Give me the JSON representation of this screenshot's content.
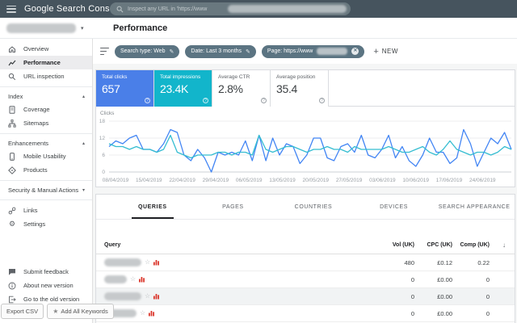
{
  "topbar": {
    "app_title": "Google Search Console",
    "search_placeholder": "Inspect any URL in 'https://www",
    "search_url_redacted": true
  },
  "property_selector": {
    "redacted": true
  },
  "page": {
    "title": "Performance"
  },
  "sidebar": {
    "items": [
      {
        "label": "Overview",
        "icon": "home-icon"
      },
      {
        "label": "Performance",
        "icon": "performance-chart-icon",
        "active": true
      },
      {
        "label": "URL inspection",
        "icon": "magnifier-icon"
      }
    ],
    "sections": [
      {
        "label": "Index",
        "state": "expanded",
        "items": [
          {
            "label": "Coverage",
            "icon": "coverage-page-icon"
          },
          {
            "label": "Sitemaps",
            "icon": "sitemap-tree-icon"
          }
        ]
      },
      {
        "label": "Enhancements",
        "state": "expanded",
        "items": [
          {
            "label": "Mobile Usability",
            "icon": "smartphone-icon"
          },
          {
            "label": "Products",
            "icon": "products-tag-icon"
          }
        ]
      },
      {
        "label": "Security & Manual Actions",
        "state": "collapsed",
        "items": []
      }
    ],
    "secondary": [
      {
        "label": "Links",
        "icon": "link-icon"
      },
      {
        "label": "Settings",
        "icon": "gear-icon"
      }
    ],
    "footer": [
      {
        "label": "Submit feedback",
        "icon": "feedback-icon"
      },
      {
        "label": "About new version",
        "icon": "info-icon"
      },
      {
        "label": "Go to the old version",
        "icon": "exit-icon"
      }
    ]
  },
  "filters": {
    "chips": [
      {
        "label": "Search type: Web",
        "trailing_icon": "edit-pencil-icon"
      },
      {
        "label": "Date: Last 3 months",
        "trailing_icon": "edit-pencil-icon"
      },
      {
        "label": "Page: https://www",
        "redacted_suffix": true,
        "trailing_icon": "remove-circle-icon"
      }
    ],
    "new_button": "NEW"
  },
  "metric_cards": [
    {
      "label": "Total clicks",
      "value": "657",
      "bg": "#4a7fe8",
      "selected": true
    },
    {
      "label": "Total impressions",
      "value": "23.4K",
      "bg": "#12b5cb",
      "selected": true
    },
    {
      "label": "Average CTR",
      "value": "2.8%",
      "bg": "#ffffff",
      "selected": false
    },
    {
      "label": "Average position",
      "value": "35.4",
      "bg": "#ffffff",
      "selected": false
    }
  ],
  "chart_data": {
    "type": "line",
    "title": "Clicks",
    "ylim": [
      0,
      18
    ],
    "yticks": [
      0,
      6,
      12,
      18
    ],
    "grid": true,
    "legend_position": "none",
    "x_tick_labels": [
      "08/04/2019",
      "15/04/2019",
      "22/04/2019",
      "29/04/2019",
      "06/05/2019",
      "13/05/2019",
      "20/05/2019",
      "27/05/2019",
      "03/06/2019",
      "10/06/2019",
      "17/06/2019",
      "24/06/2019"
    ],
    "note": "daily values Apr 8 - Jun 30 2019; impressions plotted on a scaled hidden axis",
    "series": [
      {
        "name": "Total clicks",
        "color": "#4285f4",
        "values": [
          9,
          11,
          10,
          12,
          13,
          8,
          8,
          7,
          10,
          15,
          14,
          6,
          4,
          8,
          5,
          0,
          7,
          6,
          7,
          6,
          11,
          4,
          13,
          4,
          12,
          6,
          10,
          9,
          3,
          6,
          12,
          12,
          5,
          4,
          9,
          10,
          7,
          13,
          6,
          5,
          8,
          13,
          5,
          9,
          4,
          2,
          6,
          12,
          7,
          7,
          3,
          5,
          15,
          10,
          2,
          7,
          12,
          10,
          14,
          8
        ]
      },
      {
        "name": "Total impressions (scaled)",
        "color": "#35bdd1",
        "values": [
          10,
          9,
          9,
          8,
          9,
          8,
          8,
          7,
          8,
          13,
          7,
          6,
          5,
          6,
          6,
          6,
          7,
          7,
          6,
          7,
          7,
          6,
          13,
          8,
          7,
          8,
          9,
          9,
          8,
          7,
          8,
          8,
          9,
          8,
          8,
          7,
          9,
          8,
          8,
          8,
          8,
          9,
          8,
          7,
          7,
          8,
          9,
          7,
          6,
          8,
          11,
          8,
          7,
          6,
          7,
          7,
          6,
          7,
          9,
          8
        ]
      }
    ]
  },
  "results_table": {
    "tabs": [
      {
        "label": "QUERIES",
        "active": true
      },
      {
        "label": "PAGES",
        "active": false
      },
      {
        "label": "COUNTRIES",
        "active": false
      },
      {
        "label": "DEVICES",
        "active": false
      },
      {
        "label": "SEARCH APPEARANCE",
        "active": false
      }
    ],
    "columns": {
      "query": "Query",
      "vol": "Vol (UK)",
      "cpc": "CPC (UK)",
      "comp": "Comp (UK)"
    },
    "sort_icon": "arrow-down",
    "rows": [
      {
        "query_redacted": true,
        "vol": "480",
        "cpc": "£0.12",
        "comp": "0.22"
      },
      {
        "query_redacted": true,
        "vol": "0",
        "cpc": "£0.00",
        "comp": "0"
      },
      {
        "query_redacted": true,
        "vol": "0",
        "cpc": "£0.00",
        "comp": "0",
        "highlighted": true
      },
      {
        "query_redacted": true,
        "vol": "0",
        "cpc": "£0.00",
        "comp": "0"
      }
    ]
  },
  "kwe_toolbar": {
    "export_label": "Export CSV",
    "add_all_label": "Add All Keywords"
  },
  "colors": {
    "topbar": "#46545e",
    "chip": "#5b7482",
    "clicks_blue": "#4285f4",
    "impressions_teal": "#35bdd1",
    "kwe_red": "#d93025"
  }
}
